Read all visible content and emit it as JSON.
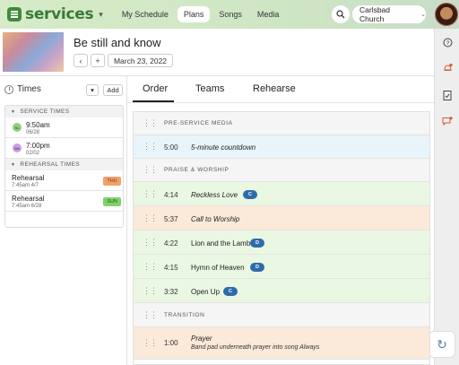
{
  "app": {
    "brand": "services",
    "nav": [
      "My Schedule",
      "Plans",
      "Songs",
      "Media"
    ],
    "active_nav": "Plans",
    "org": "Carlsbad Church"
  },
  "plan": {
    "title": "Be still and know",
    "date": "March 23, 2022",
    "prev_label": "‹",
    "add_label": "+"
  },
  "times": {
    "title": "Times",
    "add_label": "Add",
    "menu_caret": "▾",
    "service_section": "SERVICE TIMES",
    "services": [
      {
        "day": "Su",
        "time": "9:50am",
        "date": "06/28",
        "color": "#8fd17a"
      },
      {
        "day": "We",
        "time": "7:00pm",
        "date": "02/02",
        "color": "#c9a0e6"
      }
    ],
    "rehearsal_section": "REHEARSAL TIMES",
    "rehearsals": [
      {
        "name": "Rehearsal",
        "when": "7:45am 4/7",
        "tag": "THU",
        "tag_bg": "#f2a06a",
        "tag_color": "#7a3d12"
      },
      {
        "name": "Rehearsal",
        "when": "7:45am 6/28",
        "tag": "SUN",
        "tag_bg": "#7fd36b",
        "tag_color": "#22531a"
      }
    ]
  },
  "tabs": [
    "Order",
    "Teams",
    "Rehearse"
  ],
  "active_tab": "Order",
  "order": [
    {
      "kind": "header",
      "title": "PRE-SERVICE MEDIA"
    },
    {
      "kind": "item",
      "length": "5:00",
      "title": "5-minute countdown",
      "bg": "#e8f4fa"
    },
    {
      "kind": "header",
      "title": "PRAISE & WORSHIP"
    },
    {
      "kind": "item",
      "length": "4:14",
      "title": "Reckless Love",
      "key": "C",
      "bg": "#eaf7e2"
    },
    {
      "kind": "item",
      "length": "5:37",
      "title": "Call to Worship",
      "bg": "#fbe9d9"
    },
    {
      "kind": "item",
      "length": "4:22",
      "title": "Lion and the Lamb",
      "key": "D",
      "bg": "#eaf7e2"
    },
    {
      "kind": "item",
      "length": "4:15",
      "title": "Hymn of Heaven",
      "key": "D",
      "bg": "#eaf7e2"
    },
    {
      "kind": "item",
      "length": "3:32",
      "title": "Open Up",
      "key": "C",
      "bg": "#eaf7e2"
    },
    {
      "kind": "header",
      "title": "TRANSITION"
    },
    {
      "kind": "item",
      "length": "1:00",
      "title": "Prayer",
      "subtitle": "Band pad underneath prayer into song Always",
      "bg": "#fbe9d9"
    }
  ],
  "icons": {
    "rail": [
      "help-icon",
      "notifications-icon",
      "tasks-icon",
      "messages-icon"
    ],
    "fab": "refresh-icon"
  }
}
